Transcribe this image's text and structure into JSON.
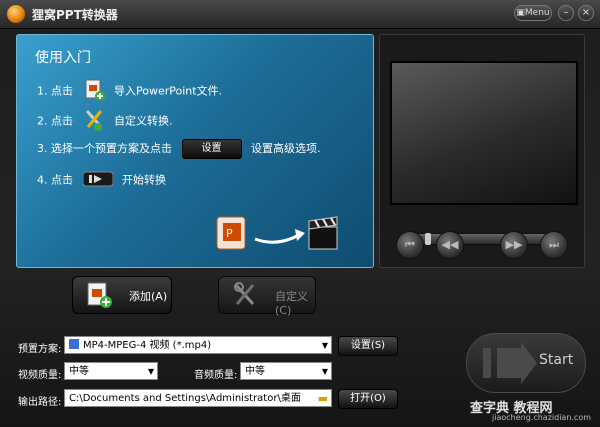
{
  "window": {
    "title": "狸窝PPT转换器",
    "menu_label": "Menu",
    "minimize": "–",
    "close": "×"
  },
  "guide": {
    "title": "使用入门",
    "step1": {
      "prefix": "1. 点击",
      "text": "导入PowerPoint文件."
    },
    "step2": {
      "prefix": "2. 点击",
      "text": "自定义转换."
    },
    "step3": {
      "prefix": "3. 选择一个预置方案及点击",
      "button": "设置",
      "text": "设置高级选项."
    },
    "step4": {
      "prefix": "4. 点击",
      "text": "开始转换"
    }
  },
  "actions": {
    "add": "添加(A)",
    "customize": "自定义(C)"
  },
  "options": {
    "preset_label": "预置方案:",
    "preset_value": "MP4-MPEG-4 视频 (*.mp4)",
    "settings_button": "设置(S)",
    "video_quality_label": "视频质量:",
    "video_quality_value": "中等",
    "audio_quality_label": "音频质量:",
    "audio_quality_value": "中等",
    "output_label": "输出路径:",
    "output_value": "C:\\Documents and Settings\\Administrator\\桌面",
    "open_button": "打开(O)"
  },
  "start": {
    "label": "Start"
  },
  "watermark": {
    "line1": "查字典 教程网",
    "line2": "jiaocheng.chazidian.com"
  },
  "colors": {
    "guide_blue": "#1d6e99",
    "accent_orange": "#e07b00",
    "ppt_red": "#d04a02"
  },
  "icons": [
    "app-logo-icon",
    "menu-icon",
    "minimize-icon",
    "close-icon",
    "ppt-add-icon",
    "tools-icon",
    "ppt-file-icon",
    "arrow-icon",
    "clapperboard-icon",
    "play-icon",
    "prev-icon",
    "rewind-icon",
    "forward-icon",
    "next-icon",
    "folder-icon",
    "dropdown-icon"
  ]
}
